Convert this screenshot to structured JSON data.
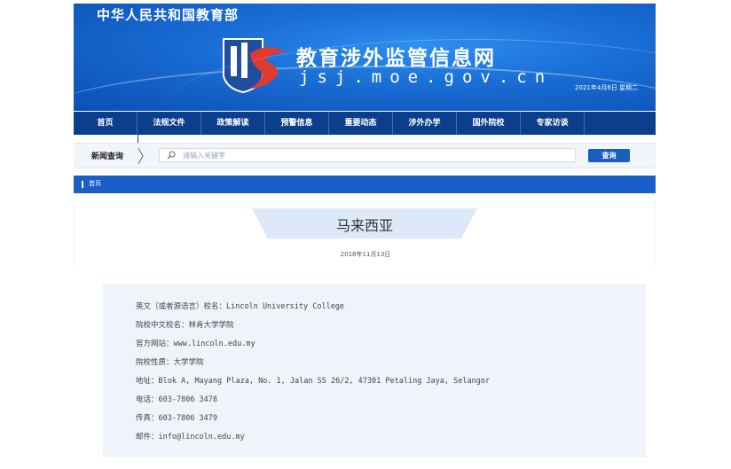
{
  "banner": {
    "ministry": "中华人民共和国教育部",
    "site_title": "教育涉外监管信息网",
    "site_domain": "jsj.moe.gov.cn",
    "date": "2021年4月6日 星期二"
  },
  "nav": {
    "items": [
      "首页",
      "法规文件",
      "政策解读",
      "预警信息",
      "重要动态",
      "涉外办学",
      "国外院校",
      "专家访谈"
    ]
  },
  "search": {
    "label": "新闻查询",
    "placeholder": "请输入关键字",
    "button": "查询"
  },
  "breadcrumb": {
    "home": "首页"
  },
  "article": {
    "title": "马来西亚",
    "date": "2018年11月13日"
  },
  "info": {
    "lines": [
      "英文（或者源语言）校名：Lincoln University College",
      "院校中文校名：林肯大学学院",
      "官方网站：www.lincoln.edu.my",
      "院校性质：大学学院",
      "地址：Blok A, Mayang Plaza, No. 1, Jalan SS 26/2, 47301 Petaling Jaya, Selangor",
      "电话：603-7806 3478",
      "传真：603-7806 3479",
      "邮件：info@lincoln.edu.my"
    ]
  },
  "colors": {
    "nav_bg": "#0b3e8c",
    "crumb_bg": "#1a5fc8",
    "button_bg": "#1a5fbf",
    "info_bg": "#eef4fa"
  }
}
